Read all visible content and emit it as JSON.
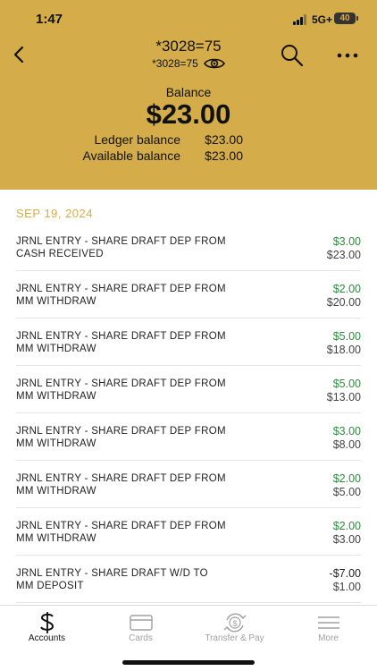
{
  "status_bar": {
    "time": "1:47",
    "network": "5G+",
    "battery": "40"
  },
  "header": {
    "title": "*3028=75",
    "subtitle": "*3028=75",
    "balance_label": "Balance",
    "balance_amount": "$23.00",
    "ledger_label": "Ledger balance",
    "ledger_value": "$23.00",
    "available_label": "Available balance",
    "available_value": "$23.00",
    "accent_color": "#d4ad4a"
  },
  "transactions": {
    "date": "SEP 19, 2024",
    "items": [
      {
        "line1": "JRNL ENTRY - SHARE DRAFT DEP FROM",
        "line2": "CASH RECEIVED",
        "amount": "$3.00",
        "balance": "$23.00",
        "kind": "credit"
      },
      {
        "line1": "JRNL ENTRY - SHARE DRAFT DEP FROM",
        "line2": "MM WITHDRAW",
        "amount": "$2.00",
        "balance": "$20.00",
        "kind": "credit"
      },
      {
        "line1": "JRNL ENTRY - SHARE DRAFT DEP FROM",
        "line2": "MM WITHDRAW",
        "amount": "$5.00",
        "balance": "$18.00",
        "kind": "credit"
      },
      {
        "line1": "JRNL ENTRY - SHARE DRAFT DEP FROM",
        "line2": "MM WITHDRAW",
        "amount": "$5.00",
        "balance": "$13.00",
        "kind": "credit"
      },
      {
        "line1": "JRNL ENTRY - SHARE DRAFT DEP FROM",
        "line2": "MM WITHDRAW",
        "amount": "$3.00",
        "balance": "$8.00",
        "kind": "credit"
      },
      {
        "line1": "JRNL ENTRY - SHARE DRAFT DEP FROM",
        "line2": "MM WITHDRAW",
        "amount": "$2.00",
        "balance": "$5.00",
        "kind": "credit"
      },
      {
        "line1": "JRNL ENTRY - SHARE DRAFT DEP FROM",
        "line2": "MM WITHDRAW",
        "amount": "$2.00",
        "balance": "$3.00",
        "kind": "credit"
      },
      {
        "line1": "JRNL ENTRY - SHARE DRAFT W/D TO",
        "line2": "MM DEPOSIT",
        "amount": "-$7.00",
        "balance": "$1.00",
        "kind": "debit"
      }
    ]
  },
  "tabs": [
    {
      "label": "Accounts",
      "icon": "dollar-icon",
      "active": true
    },
    {
      "label": "Cards",
      "icon": "card-icon",
      "active": false
    },
    {
      "label": "Transfer & Pay",
      "icon": "transfer-icon",
      "active": false
    },
    {
      "label": "More",
      "icon": "menu-icon",
      "active": false
    }
  ],
  "colors": {
    "credit": "#2e8b3d",
    "debit": "#222222",
    "accent": "#d4ad4a"
  }
}
